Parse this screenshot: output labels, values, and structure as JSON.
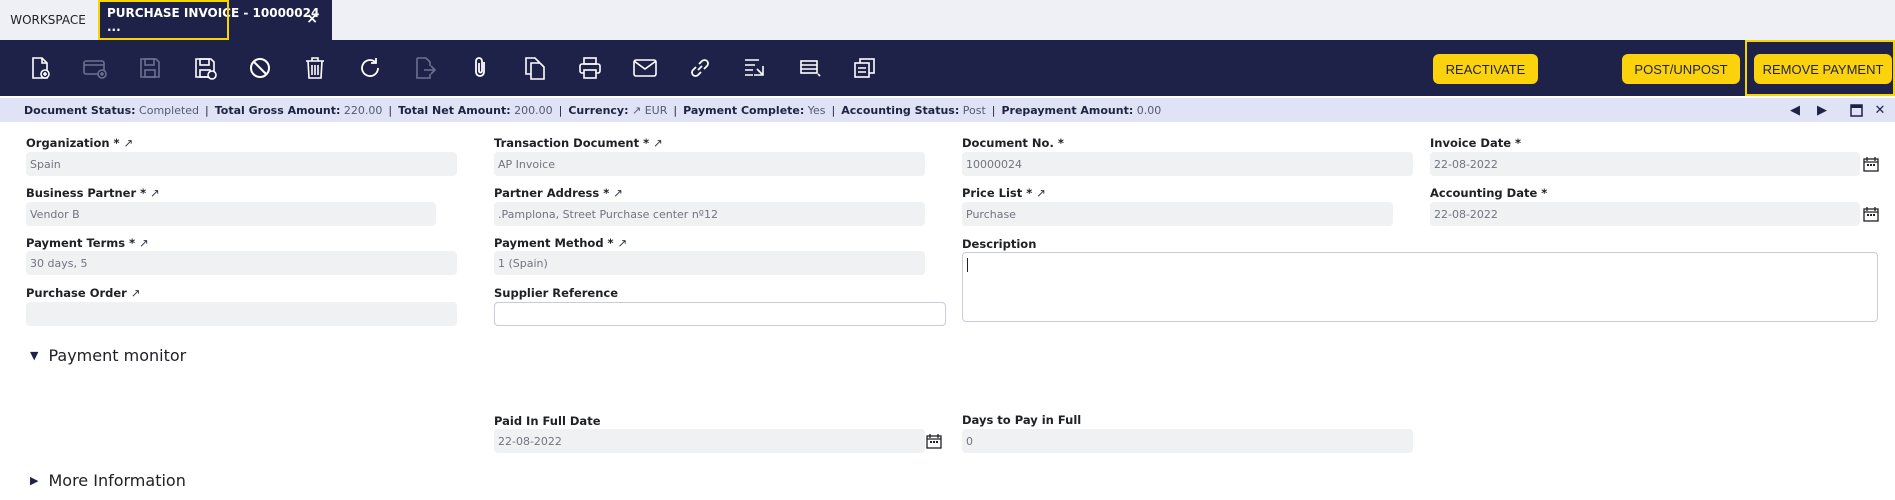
{
  "tabs": {
    "workspace": "WORKSPACE",
    "active": "PURCHASE INVOICE - 10000024 ...",
    "close": "×"
  },
  "toolbar": {
    "icons": [
      "new-document-icon",
      "new-record-icon",
      "save-icon",
      "save-close-icon",
      "cancel-icon",
      "delete-icon",
      "refresh-icon",
      "export-icon",
      "attach-icon",
      "clone-icon",
      "print-icon",
      "email-icon",
      "link-icon",
      "audit-trail-icon",
      "grid-view-icon",
      "notes-icon"
    ],
    "reactivate": "REACTIVATE",
    "post_unpost": "POST/UNPOST",
    "remove_payment": "REMOVE PAYMENT"
  },
  "status": {
    "document_status_label": "Document Status:",
    "document_status_value": "Completed",
    "total_gross_label": "Total Gross Amount:",
    "total_gross_value": "220.00",
    "total_net_label": "Total Net Amount:",
    "total_net_value": "200.00",
    "currency_label": "Currency:",
    "currency_value": "EUR",
    "payment_complete_label": "Payment Complete:",
    "payment_complete_value": "Yes",
    "accounting_status_label": "Accounting Status:",
    "accounting_status_value": "Post",
    "prepayment_label": "Prepayment Amount:",
    "prepayment_value": "0.00",
    "separator": "|"
  },
  "form": {
    "organization": {
      "label": "Organization *",
      "value": "Spain"
    },
    "transaction_document": {
      "label": "Transaction Document *",
      "value": "AP Invoice"
    },
    "document_no": {
      "label": "Document No. *",
      "value": "10000024"
    },
    "invoice_date": {
      "label": "Invoice Date *",
      "value": "22-08-2022"
    },
    "business_partner": {
      "label": "Business Partner *",
      "value": "Vendor B"
    },
    "partner_address": {
      "label": "Partner Address *",
      "value": ".Pamplona, Street Purchase center nº12"
    },
    "price_list": {
      "label": "Price List *",
      "value": "Purchase"
    },
    "accounting_date": {
      "label": "Accounting Date *",
      "value": "22-08-2022"
    },
    "payment_terms": {
      "label": "Payment Terms *",
      "value": "30 days, 5"
    },
    "payment_method": {
      "label": "Payment Method *",
      "value": "1 (Spain)"
    },
    "description": {
      "label": "Description",
      "value": ""
    },
    "purchase_order": {
      "label": "Purchase Order",
      "value": ""
    },
    "supplier_reference": {
      "label": "Supplier Reference",
      "value": ""
    }
  },
  "sections": {
    "payment_monitor": "Payment monitor",
    "more_information": "More Information"
  },
  "payment_monitor": {
    "paid_in_full_date": {
      "label": "Paid In Full Date",
      "value": "22-08-2022"
    },
    "days_to_pay": {
      "label": "Days to Pay in Full",
      "value": "0"
    }
  },
  "colors": {
    "header": "#1e2248",
    "accent": "#fbd20b",
    "status_bar": "#dfe3f5"
  }
}
